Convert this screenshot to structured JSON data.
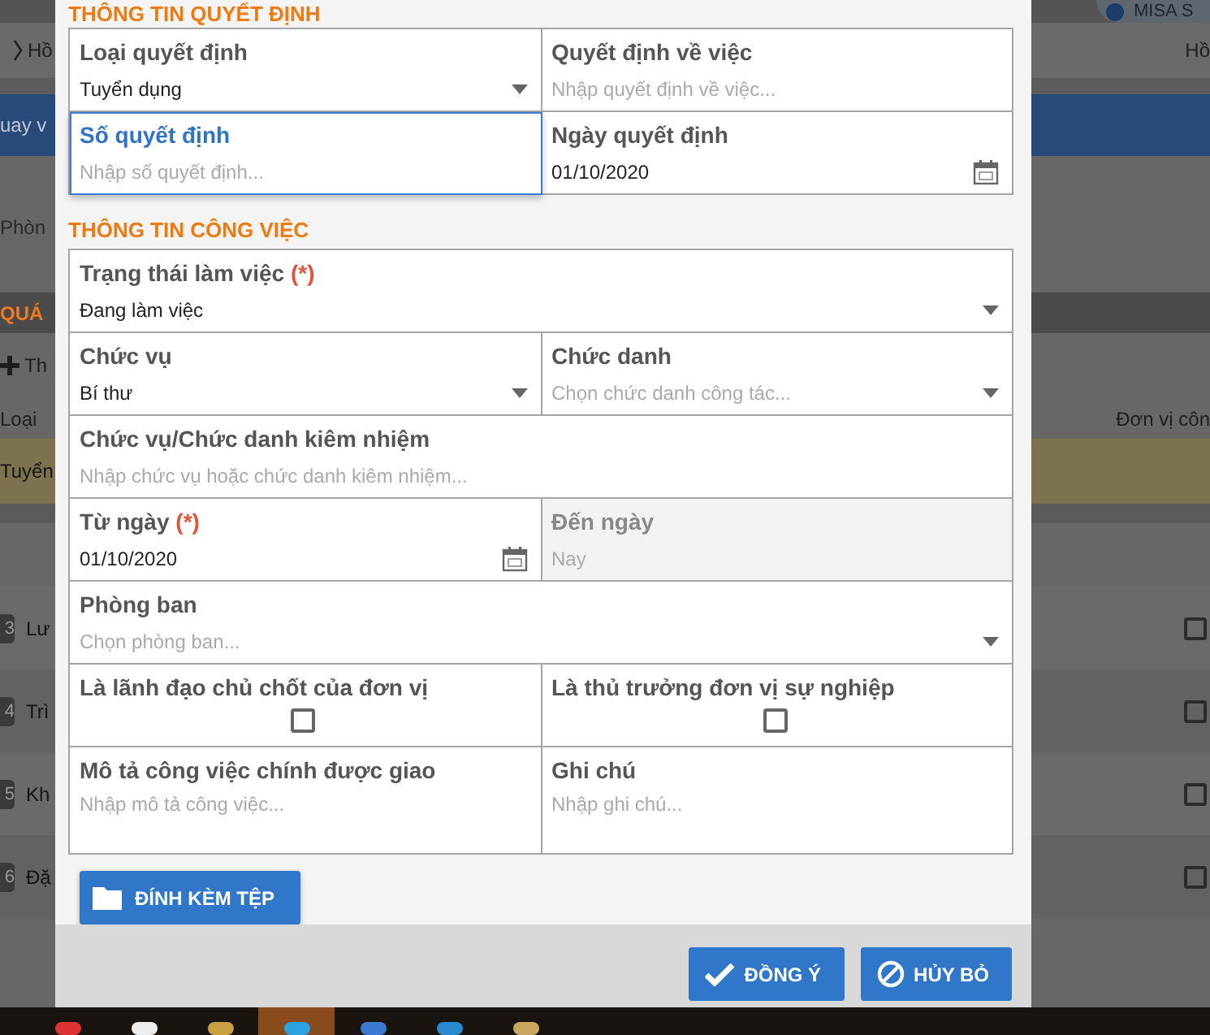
{
  "background": {
    "header_badge": "MISA S",
    "breadcrumb_left": "Hồ",
    "breadcrumb_right": "Hồ",
    "back_link": "uay v",
    "department_label": "Phòn",
    "section_title": "QUÁ",
    "add_button": "Th",
    "table": {
      "columns": [
        "Loại",
        "Đơn vị côn"
      ],
      "highlighted_row": "Tuyển",
      "rows": [
        {
          "number": "3",
          "text": "Lư",
          "checked": false
        },
        {
          "number": "4",
          "text": "Trì",
          "checked": false
        },
        {
          "number": "5",
          "text": "Kh",
          "checked": false
        },
        {
          "number": "6",
          "text": "Đặ",
          "checked": false
        }
      ]
    }
  },
  "dialog": {
    "sections": [
      {
        "title": "THÔNG TIN QUYẾT ĐỊNH",
        "fields": [
          {
            "label": "Loại quyết định",
            "kind": "select",
            "value": "Tuyển dụng",
            "wide": false,
            "focused": false,
            "disabled": false
          },
          {
            "label": "Quyết định về việc",
            "kind": "text",
            "placeholder": "Nhập quyết định về việc...",
            "wide": false,
            "focused": false,
            "disabled": false
          },
          {
            "label": "Số quyết định",
            "kind": "text",
            "placeholder": "Nhập số quyết định...",
            "wide": false,
            "focused": true,
            "disabled": false
          },
          {
            "label": "Ngày quyết định",
            "kind": "date",
            "value": "01/10/2020",
            "wide": false,
            "focused": false,
            "disabled": false
          }
        ]
      },
      {
        "title": "THÔNG TIN CÔNG VIỆC",
        "fields": [
          {
            "label": "Trạng thái làm việc",
            "kind": "select",
            "value": "Đang làm việc",
            "wide": true,
            "required_mark": "(*)",
            "focused": false,
            "disabled": false
          },
          {
            "label": "Chức vụ",
            "kind": "select",
            "value": "Bí thư",
            "wide": false,
            "focused": false,
            "disabled": false
          },
          {
            "label": "Chức danh",
            "kind": "select",
            "placeholder": "Chọn chức danh công tác...",
            "wide": false,
            "focused": false,
            "disabled": false
          },
          {
            "label": "Chức vụ/Chức danh kiêm nhiệm",
            "kind": "text",
            "placeholder": "Nhập chức vụ hoặc chức danh kiêm nhiệm...",
            "wide": true,
            "focused": false,
            "disabled": false
          },
          {
            "label": "Từ ngày",
            "kind": "date",
            "value": "01/10/2020",
            "wide": false,
            "required_mark": "(*)",
            "focused": false,
            "disabled": false
          },
          {
            "label": "Đến ngày",
            "kind": "text",
            "placeholder": "Nay",
            "wide": false,
            "focused": false,
            "disabled": true
          },
          {
            "label": "Phòng ban",
            "kind": "select",
            "placeholder": "Chọn phòng ban...",
            "wide": true,
            "focused": false,
            "disabled": false
          },
          {
            "label": "Là lãnh đạo chủ chốt của đơn vị",
            "kind": "checkbox",
            "checked": false,
            "wide": false,
            "focused": false,
            "disabled": false
          },
          {
            "label": "Là thủ trưởng đơn vị sự nghiệp",
            "kind": "checkbox",
            "checked": false,
            "wide": false,
            "focused": false,
            "disabled": false
          },
          {
            "label": "Mô tả công việc chính được giao",
            "kind": "textarea",
            "placeholder": "Nhập mô tả công việc...",
            "wide": false,
            "focused": false,
            "disabled": false
          },
          {
            "label": "Ghi chú",
            "kind": "textarea",
            "placeholder": "Nhập ghi chú...",
            "wide": false,
            "focused": false,
            "disabled": false
          }
        ]
      }
    ],
    "attach_button": "ĐÍNH KÈM TỆP",
    "buttons": [
      {
        "label": "ĐỒNG Ý",
        "kind": "confirm"
      },
      {
        "label": "HỦY BỎ",
        "kind": "cancel"
      }
    ]
  },
  "taskbar": {
    "items": [
      {
        "kind": "chrome",
        "selected": false
      },
      {
        "kind": "blank",
        "selected": false
      },
      {
        "kind": "files",
        "selected": false
      },
      {
        "kind": "skype",
        "selected": true
      },
      {
        "kind": "mail",
        "selected": false
      },
      {
        "kind": "app",
        "selected": false
      },
      {
        "kind": "paint",
        "selected": false
      }
    ]
  }
}
